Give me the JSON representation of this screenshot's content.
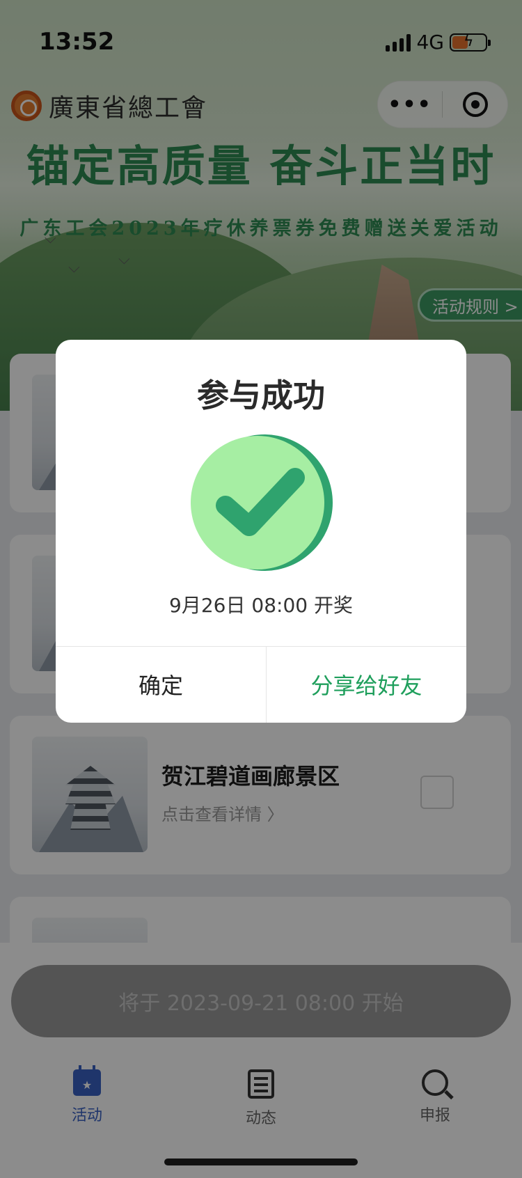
{
  "status": {
    "time": "13:52",
    "network": "4G"
  },
  "header": {
    "org_name": "廣東省總工會",
    "slogan": "锚定高质量  奋斗正当时",
    "subtitle": "广东工会2023年疗休养票券免费赠送关爱活动",
    "rules_button": "活动规则 >"
  },
  "capsule": {
    "more": "•••"
  },
  "list": {
    "items": [
      {
        "title": "",
        "link": ""
      },
      {
        "title": "",
        "link": ""
      },
      {
        "title": "贺江碧道画廊景区",
        "link": "点击查看详情 〉"
      }
    ]
  },
  "action": {
    "start_label": "将于 2023-09-21 08:00 开始"
  },
  "tabs": [
    {
      "label": "活动",
      "icon": "calendar-star-icon",
      "active": true
    },
    {
      "label": "动态",
      "icon": "document-icon",
      "active": false
    },
    {
      "label": "申报",
      "icon": "search-check-icon",
      "active": false
    }
  ],
  "dialog": {
    "title": "参与成功",
    "date": "9月26日 08:00 开奖",
    "confirm": "确定",
    "share": "分享给好友"
  },
  "colors": {
    "accent_green": "#1f9f5c",
    "tab_active": "#3a62c4",
    "check_light": "#a6eea3",
    "check_dark": "#2fa36e"
  }
}
